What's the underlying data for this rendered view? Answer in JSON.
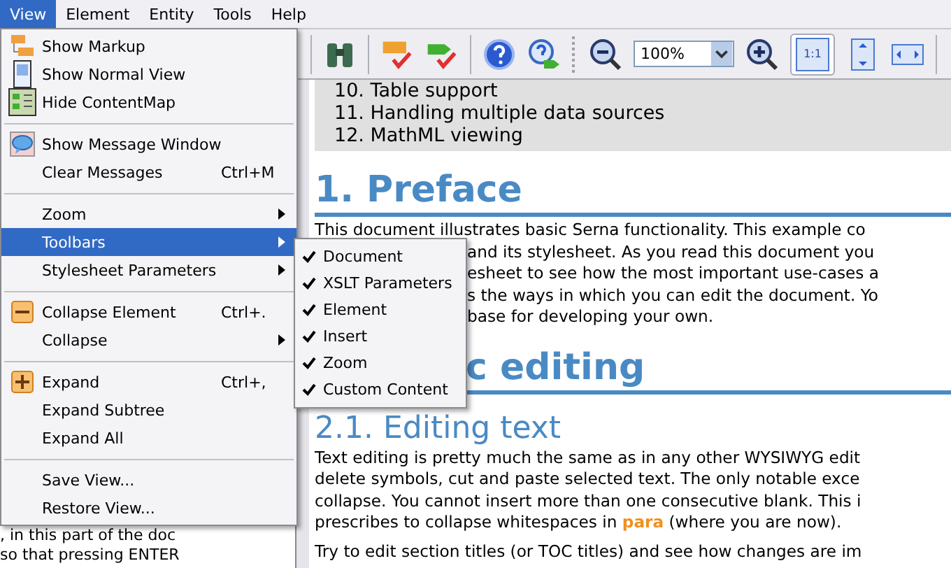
{
  "menubar": [
    {
      "label": "View",
      "selected": true
    },
    {
      "label": "Element",
      "selected": false
    },
    {
      "label": "Entity",
      "selected": false
    },
    {
      "label": "Tools",
      "selected": false
    },
    {
      "label": "Help",
      "selected": false
    }
  ],
  "toolbar": {
    "zoom_value": "100%",
    "actual_size_label": "1:1",
    "actual_size_pressed": true
  },
  "left_panel": {
    "lines": [
      ", in this part of the doc",
      "so that pressing ENTER"
    ]
  },
  "document": {
    "toc": [
      "10. Table support",
      "11. Handling multiple data sources",
      "12. MathML viewing"
    ],
    "blocks": [
      {
        "kind": "heading1",
        "text": "1. Preface"
      },
      {
        "kind": "para",
        "text": "This document illustrates basic Serna functionality. This example co"
      },
      {
        "kind": "para_covered",
        "text": "and its stylesheet. As you read this document you"
      },
      {
        "kind": "para_covered",
        "text": "esheet to see how the most important use-cases a"
      },
      {
        "kind": "para_covered",
        "text": "s the ways in which you can edit the document. Yo"
      },
      {
        "kind": "para_covered",
        "text": "base for developing your own."
      },
      {
        "kind": "heading1_covered",
        "text": "c editing"
      },
      {
        "kind": "heading2",
        "text": "2.1. Editing text"
      },
      {
        "kind": "para",
        "text": "Text editing is pretty much the same as in any other WYSIWYG edit"
      },
      {
        "kind": "para",
        "text": "delete symbols, cut and paste selected text. The only notable exce"
      },
      {
        "kind": "para",
        "text": "collapse. You cannot insert more than one consecutive blank. This i"
      },
      {
        "kind": "para",
        "text": "prescribes to collapse whitespaces in **para** (where you are now)."
      },
      {
        "kind": "para_gap",
        "text": "Try to edit section titles (or TOC titles) and see how changes are im"
      }
    ]
  },
  "view_menu": {
    "items": [
      {
        "kind": "item",
        "label": "Show Markup",
        "submenu": false,
        "selected": false
      },
      {
        "kind": "item",
        "label": "Show Normal View",
        "submenu": false,
        "selected": false
      },
      {
        "kind": "item",
        "label": "Hide ContentMap",
        "submenu": false,
        "selected": false
      },
      {
        "kind": "separator"
      },
      {
        "kind": "item",
        "label": "Show Message Window",
        "submenu": false,
        "selected": false
      },
      {
        "kind": "item",
        "label": "Clear Messages",
        "shortcut": "Ctrl+M",
        "submenu": false,
        "selected": false
      },
      {
        "kind": "separator"
      },
      {
        "kind": "item",
        "label": "Zoom",
        "submenu": true,
        "selected": false
      },
      {
        "kind": "item",
        "label": "Toolbars",
        "submenu": true,
        "selected": true
      },
      {
        "kind": "item",
        "label": "Stylesheet Parameters",
        "submenu": true,
        "selected": false
      },
      {
        "kind": "separator"
      },
      {
        "kind": "item",
        "label": "Collapse Element",
        "shortcut": "Ctrl+.",
        "submenu": false,
        "selected": false
      },
      {
        "kind": "item",
        "label": "Collapse",
        "submenu": true,
        "selected": false
      },
      {
        "kind": "separator"
      },
      {
        "kind": "item",
        "label": "Expand",
        "shortcut": "Ctrl+,",
        "submenu": false,
        "selected": false
      },
      {
        "kind": "item",
        "label": "Expand Subtree",
        "submenu": false,
        "selected": false
      },
      {
        "kind": "item",
        "label": "Expand All",
        "submenu": false,
        "selected": false
      },
      {
        "kind": "separator"
      },
      {
        "kind": "item",
        "label": "Save View...",
        "submenu": false,
        "selected": false
      },
      {
        "kind": "item",
        "label": "Restore View...",
        "submenu": false,
        "selected": false
      }
    ]
  },
  "toolbars_submenu": {
    "items": [
      {
        "label": "Document",
        "checked": true
      },
      {
        "label": "XSLT Parameters",
        "checked": true
      },
      {
        "label": "Element",
        "checked": true
      },
      {
        "label": "Insert",
        "checked": true
      },
      {
        "label": "Zoom",
        "checked": true
      },
      {
        "label": "Custom Content",
        "checked": true
      }
    ]
  }
}
